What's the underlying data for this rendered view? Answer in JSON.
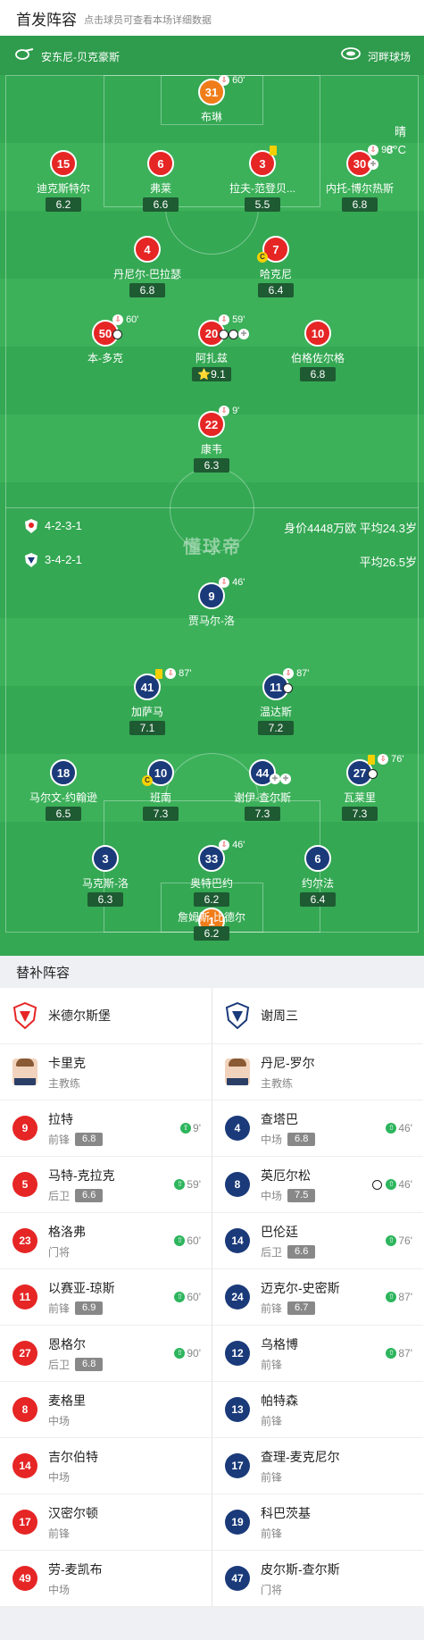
{
  "header": {
    "title": "首发阵容",
    "subtitle": "点击球员可查看本场详细数据"
  },
  "match": {
    "referee": "安东尼-贝克豪斯",
    "stadium": "河畔球场",
    "weather": "晴",
    "temperature": "8°C",
    "watermark": "懂球帝"
  },
  "home": {
    "formation": "4-2-3-1",
    "value": "身价4448万欧 平均24.3岁",
    "players": [
      {
        "num": "31",
        "name": "布琳",
        "rating": "",
        "color": "orange",
        "event": "60'"
      },
      {
        "num": "15",
        "name": "迪克斯特尔",
        "rating": "6.2",
        "color": "red"
      },
      {
        "num": "6",
        "name": "弗莱",
        "rating": "6.6",
        "color": "red"
      },
      {
        "num": "3",
        "name": "拉夫-范登贝...",
        "rating": "5.5",
        "color": "red"
      },
      {
        "num": "30",
        "name": "内托-博尔热斯",
        "rating": "6.8",
        "color": "red",
        "event": "90'"
      },
      {
        "num": "4",
        "name": "丹尼尔-巴拉瑟",
        "rating": "6.8",
        "color": "red"
      },
      {
        "num": "7",
        "name": "哈克尼",
        "rating": "6.4",
        "color": "red"
      },
      {
        "num": "50",
        "name": "本-多克",
        "rating": "",
        "color": "red",
        "event": "60'"
      },
      {
        "num": "20",
        "name": "阿扎兹",
        "rating": "9.1",
        "color": "red",
        "event": "59'"
      },
      {
        "num": "10",
        "name": "伯格佐尔格",
        "rating": "6.8",
        "color": "red"
      },
      {
        "num": "22",
        "name": "康韦",
        "rating": "6.3",
        "color": "red",
        "event": "9'"
      }
    ]
  },
  "away": {
    "formation": "3-4-2-1",
    "value": "平均26.5岁",
    "players": [
      {
        "num": "9",
        "name": "贾马尔-洛",
        "rating": "",
        "color": "blue",
        "event": "46'"
      },
      {
        "num": "41",
        "name": "加萨马",
        "rating": "7.1",
        "color": "blue",
        "event": "87'"
      },
      {
        "num": "11",
        "name": "温达斯",
        "rating": "7.2",
        "color": "blue",
        "event": "87'"
      },
      {
        "num": "18",
        "name": "马尔文-约翰逊",
        "rating": "6.5",
        "color": "blue"
      },
      {
        "num": "10",
        "name": "班南",
        "rating": "7.3",
        "color": "blue"
      },
      {
        "num": "44",
        "name": "谢伊-查尔斯",
        "rating": "7.3",
        "color": "blue"
      },
      {
        "num": "27",
        "name": "瓦莱里",
        "rating": "7.3",
        "color": "blue",
        "event": "76'"
      },
      {
        "num": "3",
        "name": "马克斯-洛",
        "rating": "6.3",
        "color": "blue"
      },
      {
        "num": "33",
        "name": "奥特巴约",
        "rating": "6.2",
        "color": "blue",
        "event": "46'"
      },
      {
        "num": "6",
        "name": "约尔法",
        "rating": "6.4",
        "color": "blue"
      },
      {
        "num": "1",
        "name": "詹姆斯-比德尔",
        "rating": "6.2",
        "color": "orange"
      }
    ]
  },
  "bench_title": "替补阵容",
  "bench": {
    "home_club": "米德尔斯堡",
    "away_club": "谢周三",
    "home_coach": {
      "name": "卡里克",
      "role": "主教练"
    },
    "away_coach": {
      "name": "丹尼-罗尔",
      "role": "主教练"
    },
    "home": [
      {
        "num": "9",
        "name": "拉特",
        "pos": "前锋",
        "rating": "6.8",
        "minute": "9'"
      },
      {
        "num": "5",
        "name": "马特-克拉克",
        "pos": "后卫",
        "rating": "6.6",
        "minute": "59'"
      },
      {
        "num": "23",
        "name": "格洛弗",
        "pos": "门将",
        "rating": "",
        "minute": "60'"
      },
      {
        "num": "11",
        "name": "以赛亚-琼斯",
        "pos": "前锋",
        "rating": "6.9",
        "minute": "60'"
      },
      {
        "num": "27",
        "name": "恩格尔",
        "pos": "后卫",
        "rating": "6.8",
        "minute": "90'"
      },
      {
        "num": "8",
        "name": "麦格里",
        "pos": "中场",
        "rating": "",
        "minute": ""
      },
      {
        "num": "14",
        "name": "吉尔伯特",
        "pos": "中场",
        "rating": "",
        "minute": ""
      },
      {
        "num": "17",
        "name": "汉密尔顿",
        "pos": "前锋",
        "rating": "",
        "minute": ""
      },
      {
        "num": "49",
        "name": "劳-麦凯布",
        "pos": "中场",
        "rating": "",
        "minute": ""
      }
    ],
    "away": [
      {
        "num": "4",
        "name": "查塔巴",
        "pos": "中场",
        "rating": "6.8",
        "minute": "46'"
      },
      {
        "num": "8",
        "name": "英厄尔松",
        "pos": "中场",
        "rating": "7.5",
        "minute": "46'"
      },
      {
        "num": "14",
        "name": "巴伦廷",
        "pos": "后卫",
        "rating": "6.6",
        "minute": "76'"
      },
      {
        "num": "24",
        "name": "迈克尔-史密斯",
        "pos": "前锋",
        "rating": "6.7",
        "minute": "87'"
      },
      {
        "num": "12",
        "name": "乌格博",
        "pos": "前锋",
        "rating": "",
        "minute": "87'"
      },
      {
        "num": "13",
        "name": "帕特森",
        "pos": "前锋",
        "rating": "",
        "minute": ""
      },
      {
        "num": "17",
        "name": "查理-麦克尼尔",
        "pos": "前锋",
        "rating": "",
        "minute": ""
      },
      {
        "num": "19",
        "name": "科巴茨基",
        "pos": "前锋",
        "rating": "",
        "minute": ""
      },
      {
        "num": "47",
        "name": "皮尔斯-查尔斯",
        "pos": "门将",
        "rating": "",
        "minute": ""
      }
    ]
  },
  "colors": {
    "pitch": "#34a853",
    "home": "#e62525",
    "away": "#1a3a7a",
    "keeper": "#f07d19"
  }
}
